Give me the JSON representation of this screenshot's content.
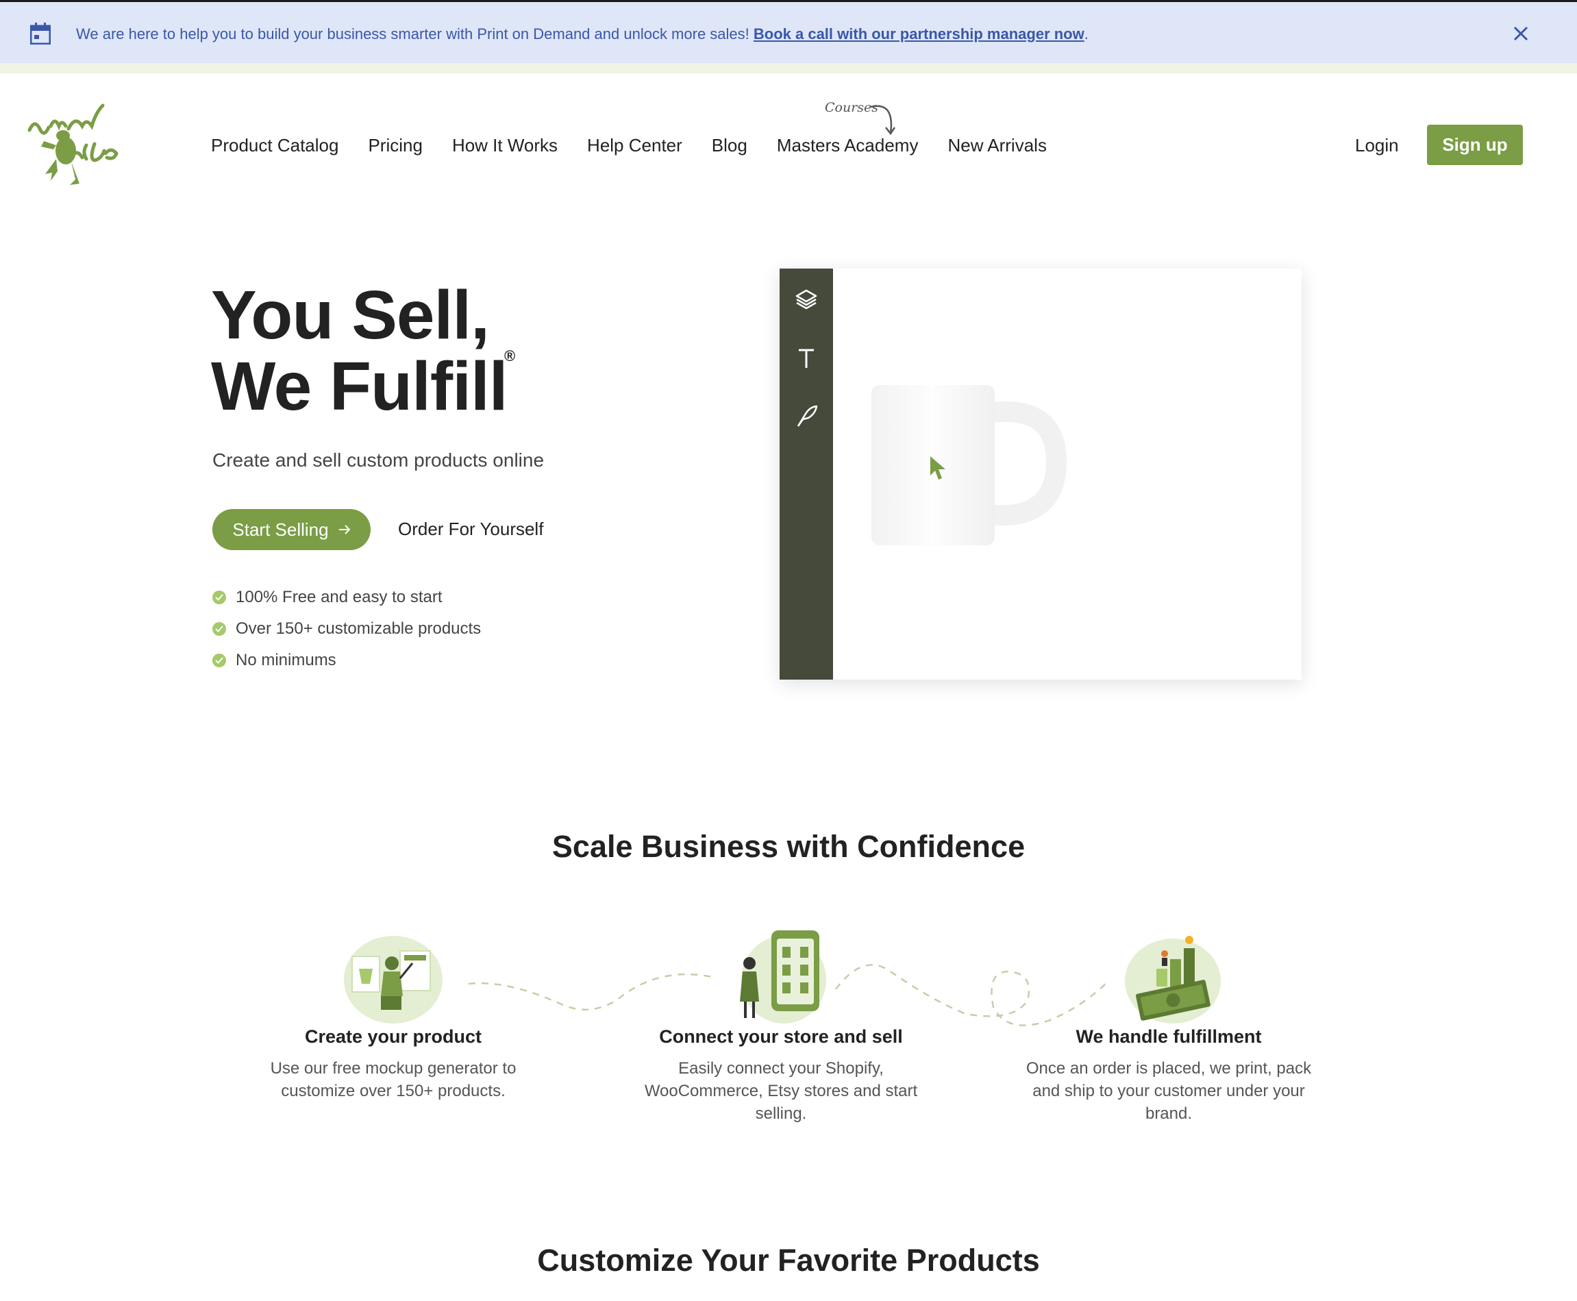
{
  "banner": {
    "text": "We are here to help you to build your business smarter with Print on Demand and unlock more sales! ",
    "link": "Book a call with our partnership manager now",
    "suffix": ".",
    "icon": "calendar-icon",
    "close_icon": "close-icon"
  },
  "brand": {
    "logo_icon": "frog-logo-icon",
    "accent": "#7a9d45",
    "dark": "#454a3a"
  },
  "nav": {
    "items": [
      {
        "label": "Product Catalog"
      },
      {
        "label": "Pricing"
      },
      {
        "label": "How It Works"
      },
      {
        "label": "Help Center"
      },
      {
        "label": "Blog"
      },
      {
        "label": "Masters Academy"
      },
      {
        "label": "New Arrivals"
      }
    ],
    "courses_note": "Courses",
    "login": "Login",
    "signup": "Sign up"
  },
  "hero": {
    "title_line1": "You Sell,",
    "title_line2": "We Fulfill",
    "registered": "®",
    "subtitle": "Create and sell custom products online",
    "start_button": "Start Selling",
    "order_button": "Order For Yourself",
    "benefits": [
      "100% Free and easy to start",
      "Over 150+ customizable products",
      "No minimums"
    ]
  },
  "editor": {
    "tools": [
      "layers-icon",
      "text-icon",
      "pen-icon"
    ]
  },
  "scale": {
    "title": "Scale Business with Confidence",
    "steps": [
      {
        "title": "Create your product",
        "text": "Use our free mockup generator to customize over 150+ products."
      },
      {
        "title": "Connect your store and sell",
        "text": "Easily connect your Shopify, WooCommerce, Etsy stores and start selling."
      },
      {
        "title": "We handle fulfillment",
        "text": "Once an order is placed, we print, pack and ship to your customer under your brand."
      }
    ]
  },
  "customize": {
    "title": "Customize Your Favorite Products"
  }
}
